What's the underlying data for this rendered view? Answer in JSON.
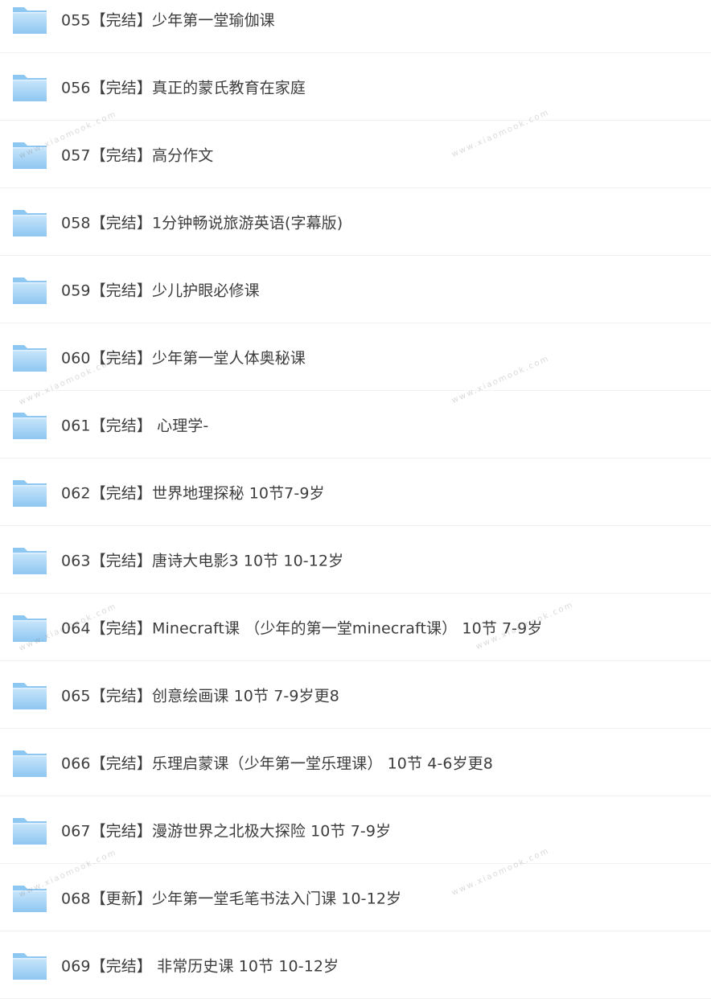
{
  "watermark": "www.xiaomook.com",
  "colors": {
    "folder_light": "#c9e6fb",
    "folder_dark": "#8ec7f1",
    "text": "#3d3d3d",
    "divider": "#f1f1f1"
  },
  "folders": [
    {
      "icon": "folder-icon",
      "label": "055【完结】少年第一堂瑜伽课"
    },
    {
      "icon": "folder-icon",
      "label": "056【完结】真正的蒙氏教育在家庭"
    },
    {
      "icon": "folder-icon",
      "label": "057【完结】高分作文"
    },
    {
      "icon": "folder-icon",
      "label": "058【完结】1分钟畅说旅游英语(字幕版)"
    },
    {
      "icon": "folder-icon",
      "label": "059【完结】少儿护眼必修课"
    },
    {
      "icon": "folder-icon",
      "label": "060【完结】少年第一堂人体奥秘课"
    },
    {
      "icon": "folder-icon",
      "label": "061【完结】 心理学-"
    },
    {
      "icon": "folder-icon",
      "label": "062【完结】世界地理探秘 10节7-9岁"
    },
    {
      "icon": "folder-icon",
      "label": "063【完结】唐诗大电影3 10节 10-12岁"
    },
    {
      "icon": "folder-icon",
      "label": "064【完结】Minecraft课 （少年的第一堂minecraft课） 10节 7-9岁"
    },
    {
      "icon": "folder-icon",
      "label": "065【完结】创意绘画课 10节 7-9岁更8"
    },
    {
      "icon": "folder-icon",
      "label": "066【完结】乐理启蒙课（少年第一堂乐理课） 10节 4-6岁更8"
    },
    {
      "icon": "folder-icon",
      "label": "067【完结】漫游世界之北极大探险 10节 7-9岁"
    },
    {
      "icon": "folder-icon",
      "label": "068【更新】少年第一堂毛笔书法入门课 10-12岁"
    },
    {
      "icon": "folder-icon",
      "label": "069【完结】 非常历史课 10节 10-12岁"
    }
  ]
}
